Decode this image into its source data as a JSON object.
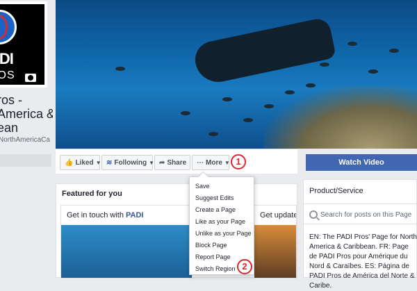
{
  "page": {
    "logo_word": "ADI",
    "logo_sub": "ROS",
    "name_lines": [
      "ros -",
      "America &",
      "ean"
    ],
    "handle": "NorthAmericaCa"
  },
  "actions": {
    "liked": "Liked",
    "following": "Following",
    "share": "Share",
    "more": "More",
    "marker_more": "1"
  },
  "sidebar": {
    "watch_video": "Watch Video",
    "category": "Product/Service",
    "search_placeholder": "Search for posts on this Page",
    "about": "EN: The PADI Pros' Page for North America & Caribbean. FR: Page de PADI Pros pour Amérique du Nord & Caraïbes. ES: Página de PADI Pros de América del Norte & Caribe."
  },
  "featured": {
    "title": "Featured for you",
    "card1_text": "Get in touch with ",
    "card1_link": "PADI",
    "card2_text": "Get updates"
  },
  "more_menu": {
    "items": [
      "Save",
      "Suggest Edits",
      "Create a Page",
      "Like as your Page",
      "Unlike as your Page",
      "Block Page",
      "Report Page",
      "Switch Region"
    ],
    "marker_switch": "2"
  },
  "colors": {
    "accent": "#4267b2",
    "marker": "#e0242e"
  }
}
